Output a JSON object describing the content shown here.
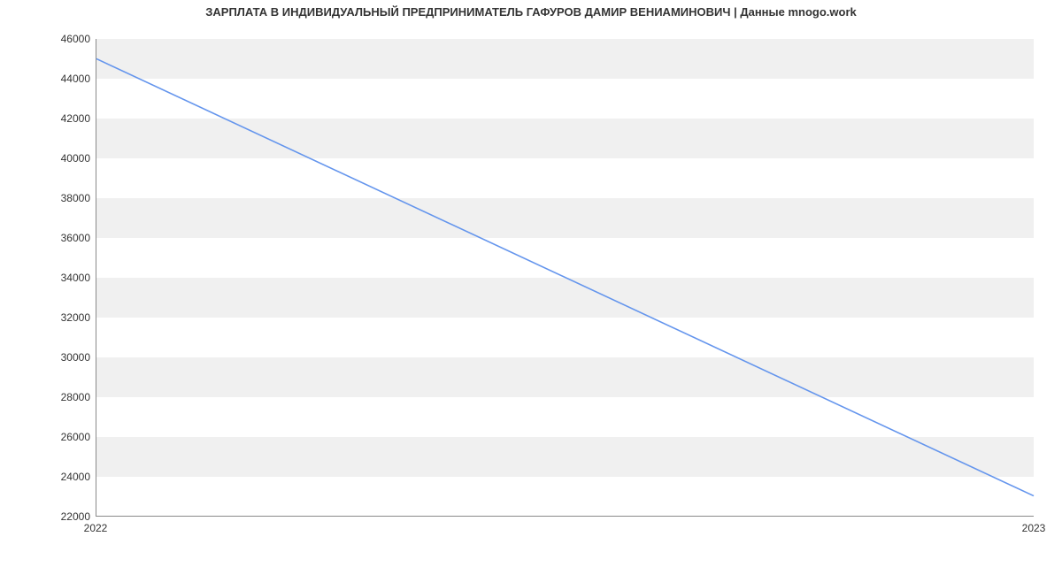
{
  "chart_data": {
    "type": "line",
    "title": "ЗАРПЛАТА В ИНДИВИДУАЛЬНЫЙ ПРЕДПРИНИМАТЕЛЬ ГАФУРОВ ДАМИР ВЕНИАМИНОВИЧ | Данные mnogo.work",
    "x": [
      "2022",
      "2023"
    ],
    "series": [
      {
        "name": "salary",
        "values": [
          45000,
          23000
        ],
        "color": "#6495ed"
      }
    ],
    "xlabel": "",
    "ylabel": "",
    "ylim": [
      22000,
      46000
    ],
    "y_ticks": [
      22000,
      24000,
      26000,
      28000,
      30000,
      32000,
      34000,
      36000,
      38000,
      40000,
      42000,
      44000,
      46000
    ],
    "x_ticks": [
      "2022",
      "2023"
    ],
    "grid_bands": true
  }
}
